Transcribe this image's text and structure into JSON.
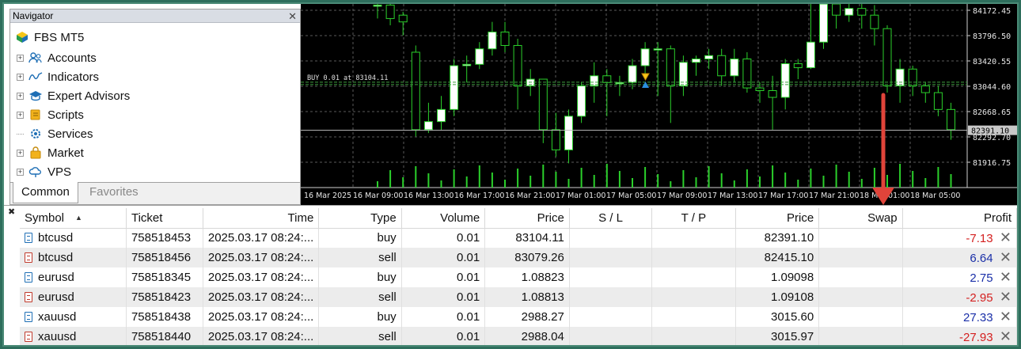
{
  "navigator": {
    "title": "Navigator",
    "root": "FBS MT5",
    "items": [
      {
        "label": "Accounts",
        "icon": "accounts-icon",
        "expandable": true
      },
      {
        "label": "Indicators",
        "icon": "indicators-icon",
        "expandable": true
      },
      {
        "label": "Expert Advisors",
        "icon": "expert-advisors-icon",
        "expandable": true
      },
      {
        "label": "Scripts",
        "icon": "scripts-icon",
        "expandable": true
      },
      {
        "label": "Services",
        "icon": "services-icon",
        "expandable": false
      },
      {
        "label": "Market",
        "icon": "market-icon",
        "expandable": true
      },
      {
        "label": "VPS",
        "icon": "vps-icon",
        "expandable": true
      }
    ],
    "tabs": {
      "common": "Common",
      "favorites": "Favorites"
    }
  },
  "chart": {
    "price_labels": [
      "84172.45",
      "83796.50",
      "83420.55",
      "83044.60",
      "82668.65",
      "82292.70",
      "81916.75"
    ],
    "current_price": "82391.10",
    "trade_label": "BUY 0.01 at 83104.11",
    "time_labels": [
      "16 Mar 2025",
      "16 Mar 09:00",
      "16 Mar 13:00",
      "16 Mar 17:00",
      "16 Mar 21:00",
      "17 Mar 01:00",
      "17 Mar 05:00",
      "17 Mar 09:00",
      "17 Mar 13:00",
      "17 Mar 17:00",
      "17 Mar 21:00",
      "18 Mar 01:00",
      "18 Mar 05:00"
    ],
    "colors": {
      "background": "#000000",
      "bull": "#ffffff",
      "bear": "#000000",
      "wick": "#2bd02b",
      "volume": "#2bd02b",
      "grid": "#5a5a5a",
      "arrow": "#e0443a"
    }
  },
  "table": {
    "headers": {
      "symbol": "Symbol",
      "ticket": "Ticket",
      "time": "Time",
      "type": "Type",
      "volume": "Volume",
      "price": "Price",
      "sl": "S / L",
      "tp": "T / P",
      "price2": "Price",
      "swap": "Swap",
      "profit": "Profit"
    },
    "rows": [
      {
        "symbol": "btcusd",
        "ticket": "758518453",
        "time": "2025.03.17 08:24:...",
        "type": "buy",
        "volume": "0.01",
        "price": "83104.11",
        "sl": "",
        "tp": "",
        "current": "82391.10",
        "swap": "",
        "profit": "-7.13"
      },
      {
        "symbol": "btcusd",
        "ticket": "758518456",
        "time": "2025.03.17 08:24:...",
        "type": "sell",
        "volume": "0.01",
        "price": "83079.26",
        "sl": "",
        "tp": "",
        "current": "82415.10",
        "swap": "",
        "profit": "6.64"
      },
      {
        "symbol": "eurusd",
        "ticket": "758518345",
        "time": "2025.03.17 08:24:...",
        "type": "buy",
        "volume": "0.01",
        "price": "1.08823",
        "sl": "",
        "tp": "",
        "current": "1.09098",
        "swap": "",
        "profit": "2.75"
      },
      {
        "symbol": "eurusd",
        "ticket": "758518423",
        "time": "2025.03.17 08:24:...",
        "type": "sell",
        "volume": "0.01",
        "price": "1.08813",
        "sl": "",
        "tp": "",
        "current": "1.09108",
        "swap": "",
        "profit": "-2.95"
      },
      {
        "symbol": "xauusd",
        "ticket": "758518438",
        "time": "2025.03.17 08:24:...",
        "type": "buy",
        "volume": "0.01",
        "price": "2988.27",
        "sl": "",
        "tp": "",
        "current": "3015.60",
        "swap": "",
        "profit": "27.33"
      },
      {
        "symbol": "xauusd",
        "ticket": "758518440",
        "time": "2025.03.17 08:24:...",
        "type": "sell",
        "volume": "0.01",
        "price": "2988.04",
        "sl": "",
        "tp": "",
        "current": "3015.97",
        "swap": "",
        "profit": "-27.93"
      }
    ]
  }
}
